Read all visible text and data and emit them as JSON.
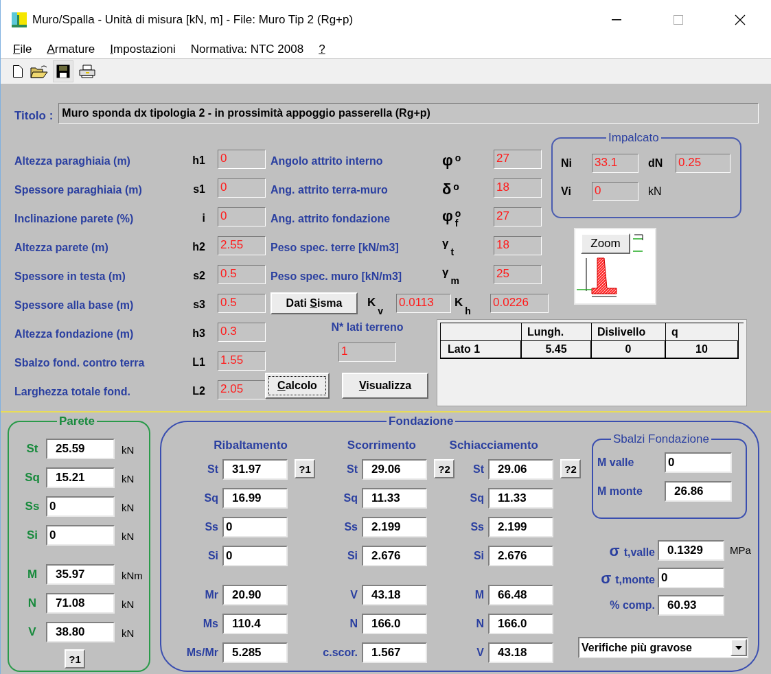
{
  "window": {
    "title": "Muro/Spalla - Unità di misura [kN, m] - File: Muro Tip 2 (Rg+p)"
  },
  "menu": [
    {
      "key": "F",
      "post": "ile"
    },
    {
      "key": "A",
      "post": "rmature"
    },
    {
      "key": "I",
      "post": "mpostazioni"
    },
    {
      "pre": "Normativa: NTC 2008"
    },
    {
      "key": "?"
    }
  ],
  "title_field": {
    "label": "Titolo :",
    "value": "Muro sponda dx tipologia 2 - in prossimità appoggio passerella (Rg+p)"
  },
  "geometry": [
    {
      "label": "Altezza paraghiaia (m)",
      "symbol": "h1",
      "value": "0"
    },
    {
      "label": "Spessore paraghiaia (m)",
      "symbol": "s1",
      "value": "0"
    },
    {
      "label": "Inclinazione parete (%)",
      "symbol": "i",
      "value": "0"
    },
    {
      "label": "Altezza parete (m)",
      "symbol": "h2",
      "value": "2.55"
    },
    {
      "label": "Spessore in testa (m)",
      "symbol": "s2",
      "value": "0.5"
    },
    {
      "label": "Spessore alla base (m)",
      "symbol": "s3",
      "value": "0.5"
    },
    {
      "label": "Altezza fondazione (m)",
      "symbol": "h3",
      "value": "0.3"
    },
    {
      "label": "Sbalzo fond. contro terra",
      "symbol": "L1",
      "value": "1.55"
    },
    {
      "label": "Larghezza totale fond.",
      "symbol": "L2",
      "value": "2.05"
    }
  ],
  "soil": [
    {
      "label": "Angolo attrito interno",
      "symbol": "φ",
      "sup": "o",
      "value": "27"
    },
    {
      "label": "Ang. attrito terra-muro",
      "symbol": "δ",
      "sup": "o",
      "value": "18"
    },
    {
      "label": "Ang. attrito fondazione",
      "symbol": "φ",
      "sup": "o",
      "sub": "f",
      "value": "27"
    },
    {
      "label": "Peso spec. terre [kN/m3]",
      "symbol": "γ",
      "sub": "t",
      "value": "18"
    },
    {
      "label": "Peso spec. muro [kN/m3]",
      "symbol": "γ",
      "sub": "m",
      "value": "25"
    }
  ],
  "seismic": {
    "button": {
      "pre": "Dati ",
      "key": "S",
      "post": "isma"
    },
    "kv": {
      "symbol": "K",
      "sub": "v",
      "value": "0.0113"
    },
    "kh": {
      "symbol": "K",
      "sub": "h",
      "value": "0.0226"
    }
  },
  "impalcato": {
    "title": "Impalcato",
    "ni": {
      "label": "Ni",
      "value": "33.1"
    },
    "dn": {
      "label": "dN",
      "value": "0.25"
    },
    "vi": {
      "label": "Vi",
      "value": "0",
      "unit": "kN"
    }
  },
  "preview": {
    "zoom_button": "Zoom"
  },
  "soil_sides": {
    "label": "N* lati terreno",
    "value": "1"
  },
  "actions": [
    {
      "key": "C",
      "post": "alcolo",
      "focused": true
    },
    {
      "key": "V",
      "post": "isualizza",
      "focused": false
    }
  ],
  "sides_table": {
    "columns": [
      "",
      "Lungh.",
      "Dislivello",
      "q"
    ],
    "rows": [
      [
        "Lato 1",
        "5.45",
        "0",
        "10"
      ]
    ]
  },
  "parete": {
    "title": "Parete",
    "groups": [
      [
        {
          "label": "St",
          "value": "25.59",
          "unit": "kN"
        },
        {
          "label": "Sq",
          "value": "15.21",
          "unit": "kN"
        },
        {
          "label": "Ss",
          "value": "0",
          "unit": "kN"
        },
        {
          "label": "Si",
          "value": "0",
          "unit": "kN"
        }
      ],
      [
        {
          "label": "M",
          "value": "35.97",
          "unit": "kNm"
        },
        {
          "label": "N",
          "value": "71.08",
          "unit": "kN"
        },
        {
          "label": "V",
          "value": "38.80",
          "unit": "kN"
        }
      ]
    ],
    "help": "?1"
  },
  "fondazione": {
    "title": "Fondazione",
    "columns": [
      {
        "title": "Ribaltamento",
        "help": "?1",
        "groups": [
          [
            {
              "label": "St",
              "value": "31.97"
            },
            {
              "label": "Sq",
              "value": "16.99"
            },
            {
              "label": "Ss",
              "value": "0"
            },
            {
              "label": "Si",
              "value": "0"
            }
          ],
          [
            {
              "label": "Mr",
              "value": "20.90"
            },
            {
              "label": "Ms",
              "value": "110.4"
            },
            {
              "label": "Ms/Mr",
              "value": "5.285"
            }
          ]
        ]
      },
      {
        "title": "Scorrimento",
        "help": "?2",
        "groups": [
          [
            {
              "label": "St",
              "value": "29.06"
            },
            {
              "label": "Sq",
              "value": "11.33"
            },
            {
              "label": "Ss",
              "value": "2.199"
            },
            {
              "label": "Si",
              "value": "2.676"
            }
          ],
          [
            {
              "label": "V",
              "value": "43.18"
            },
            {
              "label": "N",
              "value": "166.0"
            },
            {
              "label": "c.scor.",
              "value": "1.567"
            }
          ]
        ]
      },
      {
        "title": "Schiacciamento",
        "help": "?2",
        "groups": [
          [
            {
              "label": "St",
              "value": "29.06"
            },
            {
              "label": "Sq",
              "value": "11.33"
            },
            {
              "label": "Ss",
              "value": "2.199"
            },
            {
              "label": "Si",
              "value": "2.676"
            }
          ],
          [
            {
              "label": "M",
              "value": "66.48"
            },
            {
              "label": "N",
              "value": "166.0"
            },
            {
              "label": "V",
              "value": "43.18"
            }
          ]
        ]
      }
    ],
    "sbalzi": {
      "title": "Sbalzi Fondazione",
      "rows": [
        {
          "label": "M valle",
          "value": "0"
        },
        {
          "label": "M monte",
          "value": "26.86"
        }
      ]
    },
    "stresses": [
      {
        "symbol": "σ",
        "label": "t,valle",
        "value": "0.1329",
        "unit": "MPa"
      },
      {
        "symbol": "σ",
        "label": "t,monte",
        "value": "0"
      },
      {
        "label": "% comp.",
        "value": "60.93"
      }
    ],
    "dropdown": {
      "value": "Verifiche più gravose"
    }
  }
}
